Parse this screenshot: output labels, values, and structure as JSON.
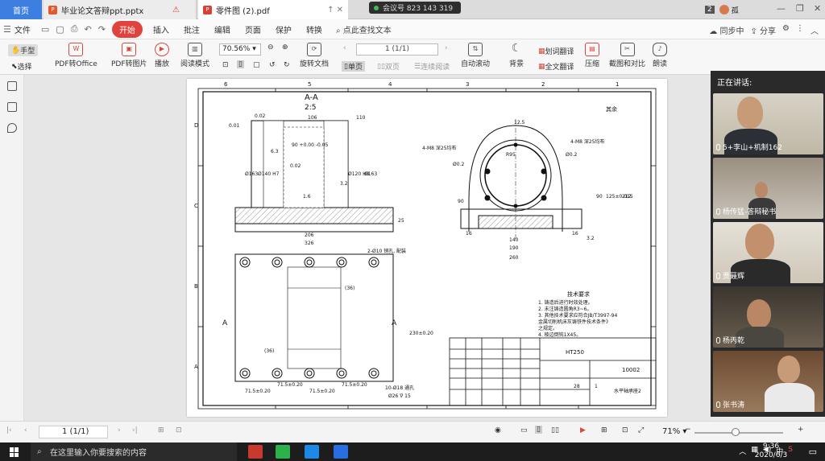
{
  "tabs": {
    "home": "首页",
    "tab1": "毕业论文答辩ppt.pptx",
    "tab2": "零件图 (2).pdf",
    "user_name": "孤",
    "notif_count": "2"
  },
  "meeting": {
    "label": "会议号 823 143 319"
  },
  "menu": {
    "file": "文件",
    "start": "开始",
    "insert": "插入",
    "annotate": "批注",
    "edit": "编辑",
    "page": "页面",
    "protect": "保护",
    "convert": "转换",
    "search": "点此查找文本",
    "sync": "同步中",
    "share": "分享"
  },
  "toolbar": {
    "hand": "手型",
    "select": "选择",
    "pdf2office": "PDF转Office",
    "pdf2img": "PDF转图片",
    "play": "播放",
    "readmode": "阅读模式",
    "zoom": "70.56%",
    "rotate": "旋转文档",
    "page": "1 (1/1)",
    "single": "单页",
    "double": "双页",
    "continuous": "连续阅读",
    "autoscroll": "自动滚动",
    "background": "背景",
    "wordtrans": "划词翻译",
    "fulltrans": "全文翻译",
    "compress": "压缩",
    "screenshot": "截图和对比",
    "read": "朗读"
  },
  "status": {
    "page": "1 (1/1)",
    "zoom": "71%"
  },
  "video": {
    "title": "正在讲话:",
    "participants": [
      "5+李山+机制162",
      "杨传猛-答辩秘书",
      "贾聂辉",
      "杨丙乾",
      "张书涛"
    ]
  },
  "taskbar": {
    "search": "在这里输入你要搜索的内容",
    "time": "9:36",
    "date": "2020/6/3",
    "ime": "中"
  },
  "drawing": {
    "section_title": "A-A",
    "scale": "2:5",
    "roughness_note": "其余",
    "dims": [
      "106",
      "110",
      "90 +0.00 -0.05",
      "Ø163",
      "Ø140 H7",
      "Ø120 H8",
      "Ø163",
      "206",
      "326",
      "25",
      "12.5",
      "4-M8 深25均布",
      "4-M8 深25均布",
      "R95",
      "Ø0.2",
      "Ø0.2",
      "90",
      "90",
      "125±0.015",
      "212",
      "16",
      "16",
      "140",
      "190",
      "260",
      "3.2",
      "2-Ø10 销孔, 配装",
      "(36)",
      "230±0.20",
      "(36)",
      "71.5±0.20",
      "71.5±0.20",
      "71.5±0.20",
      "71.5±0.20",
      "10-Ø18 通孔",
      "Ø26 ∇ 15",
      "0.02",
      "0.01",
      "0.02",
      "1.6",
      "6.3",
      "3.2"
    ],
    "notes_title": "技术要求",
    "notes": [
      "1. 铸造后进行时效处理。",
      "2. 未注铸造圆角R3~6。",
      "3. 其他技术要求应符合JB/T3997-94",
      "   金属切削机床灰铸铁件技术条件》",
      "   之规定。",
      "4. 棱边倒钝1X45。"
    ],
    "tb_material": "HT250",
    "tb_drawing_no": "10002",
    "tb_name": "水平轴承座2",
    "tb_scale": "28",
    "tb_sheets": "1",
    "grid_top": [
      "6",
      "5",
      "4",
      "3",
      "2",
      "1"
    ],
    "grid_side": [
      "D",
      "C",
      "B",
      "A"
    ],
    "section_mark": "A"
  },
  "colors": {
    "accent": "#e0433d",
    "tab_blue": "#3d7fe0",
    "wps_red": "#d04a40"
  }
}
